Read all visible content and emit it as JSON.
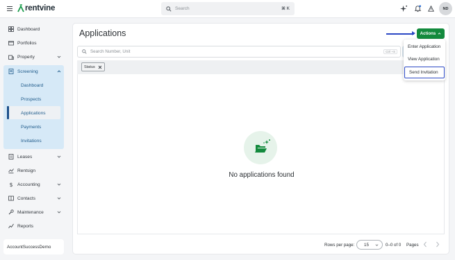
{
  "app": {
    "name": "rentvine"
  },
  "topbar": {
    "search_placeholder": "Search",
    "search_shortcut": "⌘ K",
    "avatar_initials": "ND"
  },
  "sidebar": {
    "items": [
      {
        "label": "Dashboard",
        "icon": "dashboard-icon"
      },
      {
        "label": "Portfolios",
        "icon": "portfolio-icon"
      },
      {
        "label": "Property",
        "icon": "property-icon",
        "has_chevron": true
      },
      {
        "label": "Screening",
        "icon": "screening-icon",
        "expanded": true
      },
      {
        "label": "Leases",
        "icon": "leases-icon",
        "has_chevron": true
      },
      {
        "label": "Rentsign",
        "icon": "rentsign-icon"
      },
      {
        "label": "Accounting",
        "icon": "dollar-icon",
        "has_chevron": true
      },
      {
        "label": "Contacts",
        "icon": "contacts-icon",
        "has_chevron": true
      },
      {
        "label": "Maintenance",
        "icon": "wrench-icon",
        "has_chevron": true
      },
      {
        "label": "Reports",
        "icon": "reports-icon"
      }
    ],
    "screening_sub": [
      "Dashboard",
      "Prospects",
      "Applications",
      "Payments",
      "Invitations"
    ],
    "active_sub": "Applications",
    "account_name": "AccountSuccessDemo"
  },
  "main": {
    "title": "Applications",
    "actions_label": "Actions",
    "search_placeholder": "Search Number, Unit",
    "search_shortcut": "Ctrl +S",
    "filter_chip": "Status",
    "empty_message": "No applications found"
  },
  "actions_menu": {
    "items": [
      "Enter Application",
      "View Application",
      "Send Invitation"
    ],
    "highlighted": "Send Invitation"
  },
  "pagination": {
    "rows_label": "Rows per page:",
    "rows_value": "15",
    "range": "0–0 of 0",
    "pages_label": "Pages"
  },
  "colors": {
    "brand_green": "#138a3d",
    "active_nav_bg": "#d6e9f7",
    "highlight_blue": "#2a47c4"
  }
}
